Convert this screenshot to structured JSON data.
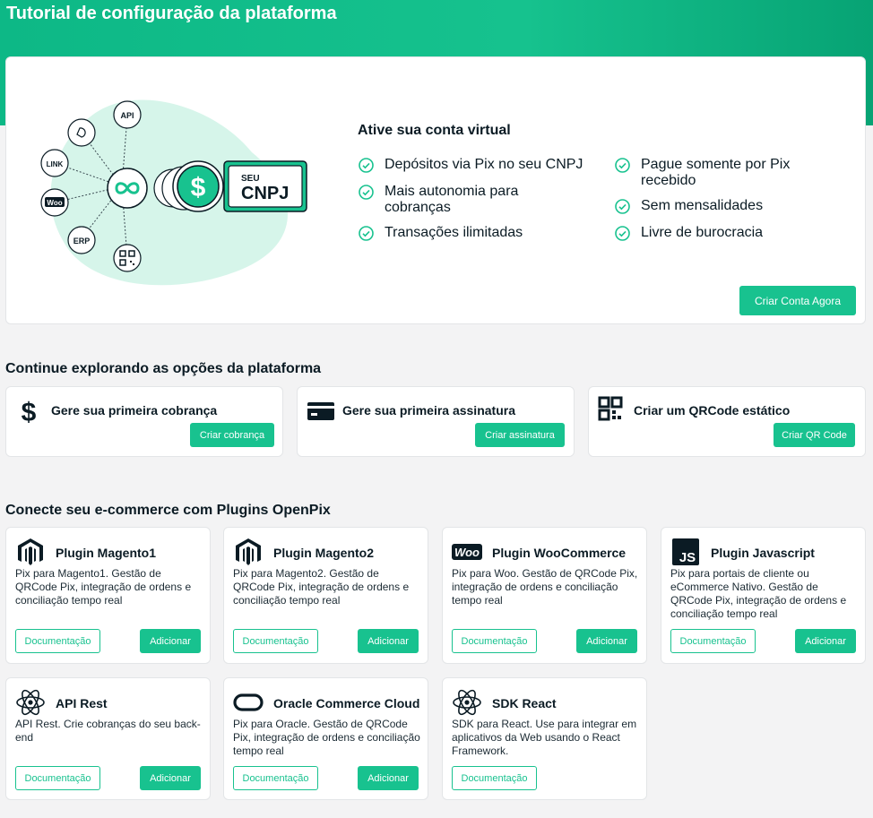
{
  "page": {
    "title": "Tutorial de configuração da plataforma"
  },
  "hero": {
    "heading": "Ative sua conta virtual",
    "features_left": [
      "Depósitos via Pix no seu CNPJ",
      "Mais autonomia para cobranças",
      "Transações ilimitadas"
    ],
    "features_right": [
      "Pague somente por Pix recebido",
      "Sem mensalidades",
      "Livre de burocracia"
    ],
    "cta": "Criar Conta Agora",
    "illustration": {
      "nodes": [
        "API",
        "LINK",
        "ERP"
      ],
      "badge_top": "SEU",
      "badge_bottom": "CNPJ",
      "woo": "Woo"
    }
  },
  "explore": {
    "title": "Continue explorando as opções da plataforma",
    "cards": [
      {
        "label": "Gere sua primeira cobrança",
        "button": "Criar cobrança",
        "icon": "dollar-icon"
      },
      {
        "label": "Gere sua primeira assinatura",
        "button": "Criar assinatura",
        "icon": "credit-card-icon"
      },
      {
        "label": "Criar um QRCode estático",
        "button": "Criar QR Code",
        "icon": "qrcode-icon"
      }
    ]
  },
  "plugins": {
    "title": "Conecte seu e-commerce com Plugins OpenPix",
    "doc_label": "Documentação",
    "add_label": "Adicionar",
    "items": [
      {
        "name": "Plugin Magento1",
        "desc": "Pix para Magento1. Gestão de QRCode Pix, integração de ordens e conciliação tempo real",
        "icon": "magento-icon"
      },
      {
        "name": "Plugin Magento2",
        "desc": "Pix para Magento2. Gestão de QRCode Pix, integração de ordens e conciliação tempo real",
        "icon": "magento-icon"
      },
      {
        "name": "Plugin WooCommerce",
        "desc": "Pix para Woo. Gestão de QRCode Pix, integração de ordens e conciliação tempo real",
        "icon": "woocommerce-icon",
        "icon_text": "Woo"
      },
      {
        "name": "Plugin Javascript",
        "desc": "Pix para portais de cliente ou eCommerce Nativo. Gestão de QRCode Pix, integração de ordens e conciliação tempo real",
        "icon": "javascript-icon",
        "icon_text": "JS"
      },
      {
        "name": "API Rest",
        "desc": "API Rest. Crie cobranças do seu back-end",
        "icon": "react-icon"
      },
      {
        "name": "Oracle Commerce Cloud",
        "desc": "Pix para Oracle. Gestão de QRCode Pix, integração de ordens e conciliação tempo real",
        "icon": "oracle-icon"
      },
      {
        "name": "SDK React",
        "desc": "SDK para React. Use para integrar em aplicativos da Web usando o React Framework.",
        "icon": "react-icon"
      }
    ]
  },
  "colors": {
    "accent": "#18c28f",
    "hero_gradient_start": "#0db886",
    "hero_gradient_end": "#07a374",
    "text": "#0b1b24",
    "blob": "#d6f5ea"
  }
}
